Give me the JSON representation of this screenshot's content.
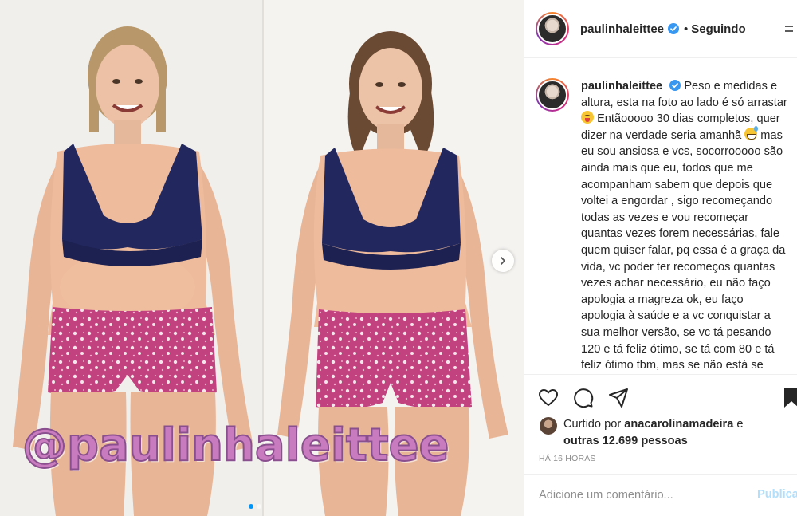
{
  "post": {
    "username": "paulinhaleittee",
    "follow_separator": "•",
    "follow_status": "Seguindo",
    "watermark": "@paulinhaleittee",
    "caption_parts": [
      "Peso e medidas e altura, esta na foto ao lado é só arrastar ",
      "Entãooooo 30 dias completos, quer dizer na verdade seria amanhã ",
      " mas eu sou ansiosa e vcs, socorrooooo são ainda mais que eu, todos que me acompanham sabem que depois que voltei a engordar , sigo recomeçando todas as vezes e vou recomeçar quantas vezes forem necessárias, fale quem quiser falar, pq essa é a graça da vida, vc poder ter recomeços quantas vezes achar necessário, eu não faço apologia a magreza ok, eu faço apologia à saúde e a vc conquistar a sua melhor versão, se vc tá pesando 120 e tá feliz ótimo, se tá com 80 e tá feliz ótimo tbm, mas se não está se sentindo bem e deseja"
    ],
    "emojis": [
      "tongue-out-emoji",
      "sweat-smile-emoji"
    ],
    "likes": {
      "prefix": "Curtido por ",
      "user": "anacarolinamadeira",
      "joiner": " e",
      "others": "outras 12.699 pessoas"
    },
    "time": "HÁ 16 HORAS",
    "comment_placeholder": "Adicione um comentário...",
    "publish_label": "Publica"
  },
  "icons": {
    "like": "heart-icon",
    "comment": "comment-icon",
    "share": "share-icon",
    "save": "bookmark-icon",
    "next": "chevron-right-icon",
    "verified": "verified-badge-icon",
    "more": "more-options-icon"
  },
  "colors": {
    "verified": "#3897f0",
    "publish": "#b2dffc",
    "border": "#efefef",
    "watermark": "#c97bbf"
  }
}
